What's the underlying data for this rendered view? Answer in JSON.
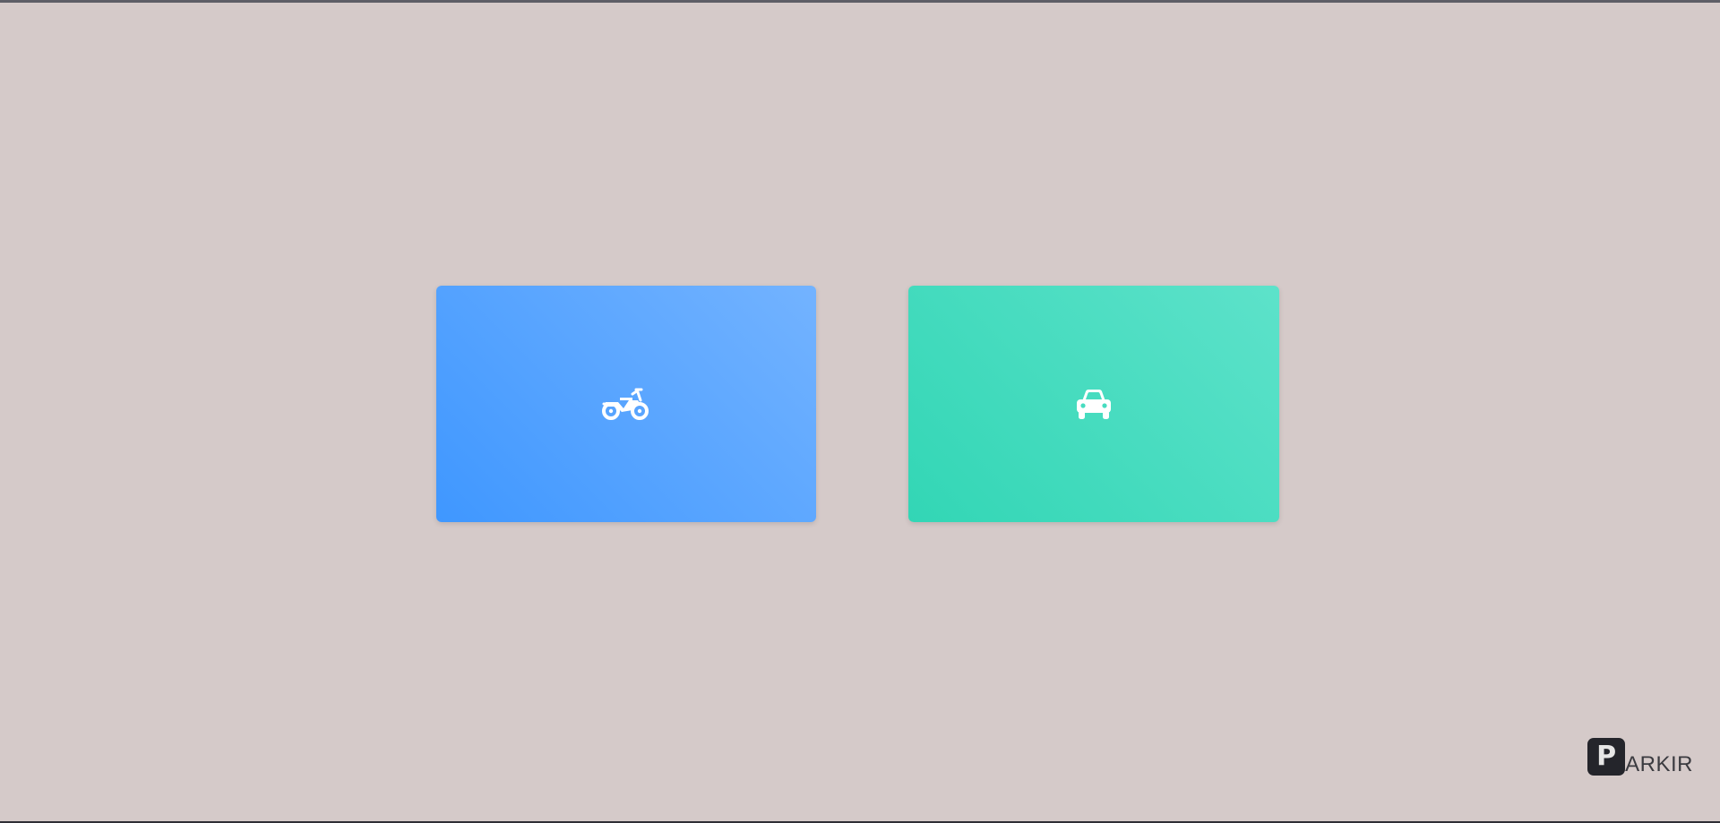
{
  "page": {
    "background": "#d5cac9"
  },
  "cards": [
    {
      "id": "motorcycle",
      "icon": "motorcycle-icon",
      "gradient_start": "#3f97ff",
      "gradient_end": "#73b3ff"
    },
    {
      "id": "car",
      "icon": "car-icon",
      "gradient_start": "#32d6b5",
      "gradient_end": "#5de2ca"
    }
  ],
  "brand": {
    "logo_letter": "P",
    "text": "ARKIR"
  }
}
